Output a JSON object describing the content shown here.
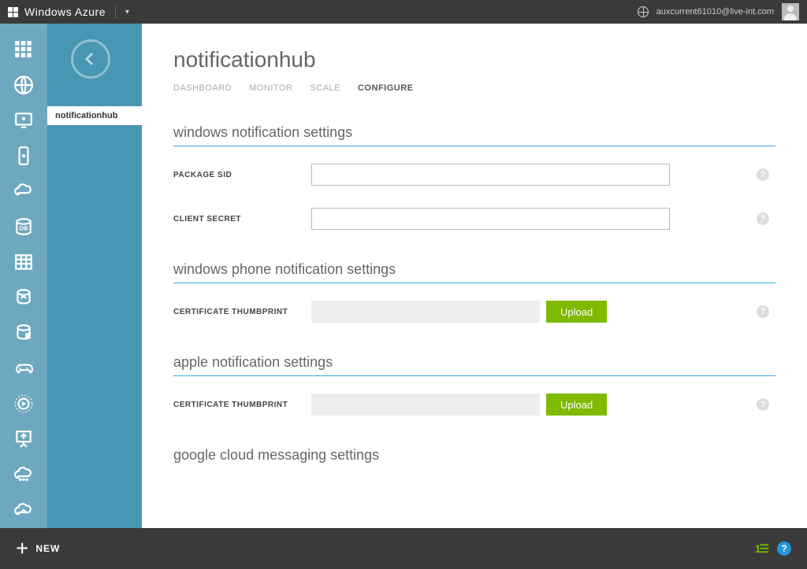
{
  "brand": "Windows Azure",
  "user_email": "auxcurrent61010@live-int.com",
  "subnav_item": "notificationhub",
  "page_title": "notificationhub",
  "tabs": {
    "dashboard": "DASHBOARD",
    "monitor": "MONITOR",
    "scale": "SCALE",
    "configure": "CONFIGURE"
  },
  "sections": {
    "windows": {
      "title": "windows notification settings",
      "package_sid_label": "PACKAGE SID",
      "package_sid_value": "",
      "client_secret_label": "CLIENT SECRET",
      "client_secret_value": ""
    },
    "wp": {
      "title": "windows phone notification settings",
      "cert_label": "CERTIFICATE THUMBPRINT",
      "cert_value": "",
      "upload_label": "Upload"
    },
    "apple": {
      "title": "apple notification settings",
      "cert_label": "CERTIFICATE THUMBPRINT",
      "cert_value": "",
      "upload_label": "Upload"
    },
    "gcm": {
      "title": "google cloud messaging settings"
    }
  },
  "bottom": {
    "new_label": "NEW",
    "status_count": "1"
  },
  "colors": {
    "sidebar_bg": "#6ea8bf",
    "subnav_bg": "#4796b3",
    "accent": "#7fba00",
    "section_rule": "#3ba9dd"
  }
}
